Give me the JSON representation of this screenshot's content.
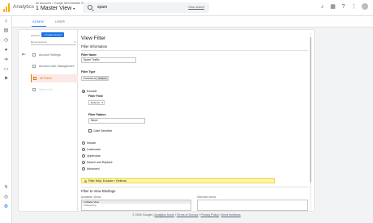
{
  "app": {
    "title": "Analytics",
    "account_line": "All accounts > Google Merchandise St...",
    "view_title": "1 Master View",
    "view_caret": "▾"
  },
  "search": {
    "value": "spam",
    "clear_label": "Clear search"
  },
  "top_icons": [
    "bell-icon",
    "apps-icon",
    "help-icon",
    "more-icon"
  ],
  "leftnav_icons": [
    "home-icon",
    "customization-icon",
    "realtime-icon",
    "audience-icon",
    "acquisition-icon",
    "behavior-icon",
    "conversions-icon",
    "attribution-icon",
    "discover-icon",
    "admin-icon"
  ],
  "tabs": [
    {
      "label": "ADMIN",
      "active": true
    },
    {
      "label": "USER",
      "active": false
    }
  ],
  "left_column": {
    "account_label": "Account",
    "create_account_label": "+ Create Account",
    "account_select": "Demo Account",
    "menu": [
      {
        "label": "Account Settings",
        "active": false,
        "dim": false
      },
      {
        "label": "Account User Management",
        "active": false,
        "dim": false
      },
      {
        "label": "All Filters",
        "active": true,
        "dim": false
      },
      {
        "label": "Trash Can",
        "active": false,
        "dim": true
      }
    ]
  },
  "form": {
    "title": "View Filter",
    "filter_information": "Filter Information",
    "filter_name_label": "Filter Name",
    "filter_name_value": "Spam Traffic",
    "filter_type_label": "Filter Type",
    "filter_type_options": [
      "Predefined",
      "Custom"
    ],
    "filter_type_selected": "Custom",
    "exclude_label": "Exclude",
    "filter_field_label": "Filter Field",
    "filter_field_value": "Referral",
    "filter_pattern_label": "Filter Pattern",
    "filter_pattern_value": "Word",
    "case_sensitive_label": "Case Sensitive",
    "other_types": [
      "Include",
      "Lowercase",
      "Uppercase",
      "Search and Replace",
      "Advanced"
    ],
    "help_text": "Filter Help: Exclude » Referral",
    "apply_to_views": "Filter to View Bindings",
    "available_views_label": "Available Views",
    "available_views": [
      "1 Master View",
      "2 Reporting"
    ],
    "selected_views_label": "Selected views"
  },
  "footer": {
    "copyright": "© 2020 Google",
    "links": [
      "Analytics home",
      "Terms of Service",
      "Privacy Policy",
      "Send feedback"
    ]
  }
}
